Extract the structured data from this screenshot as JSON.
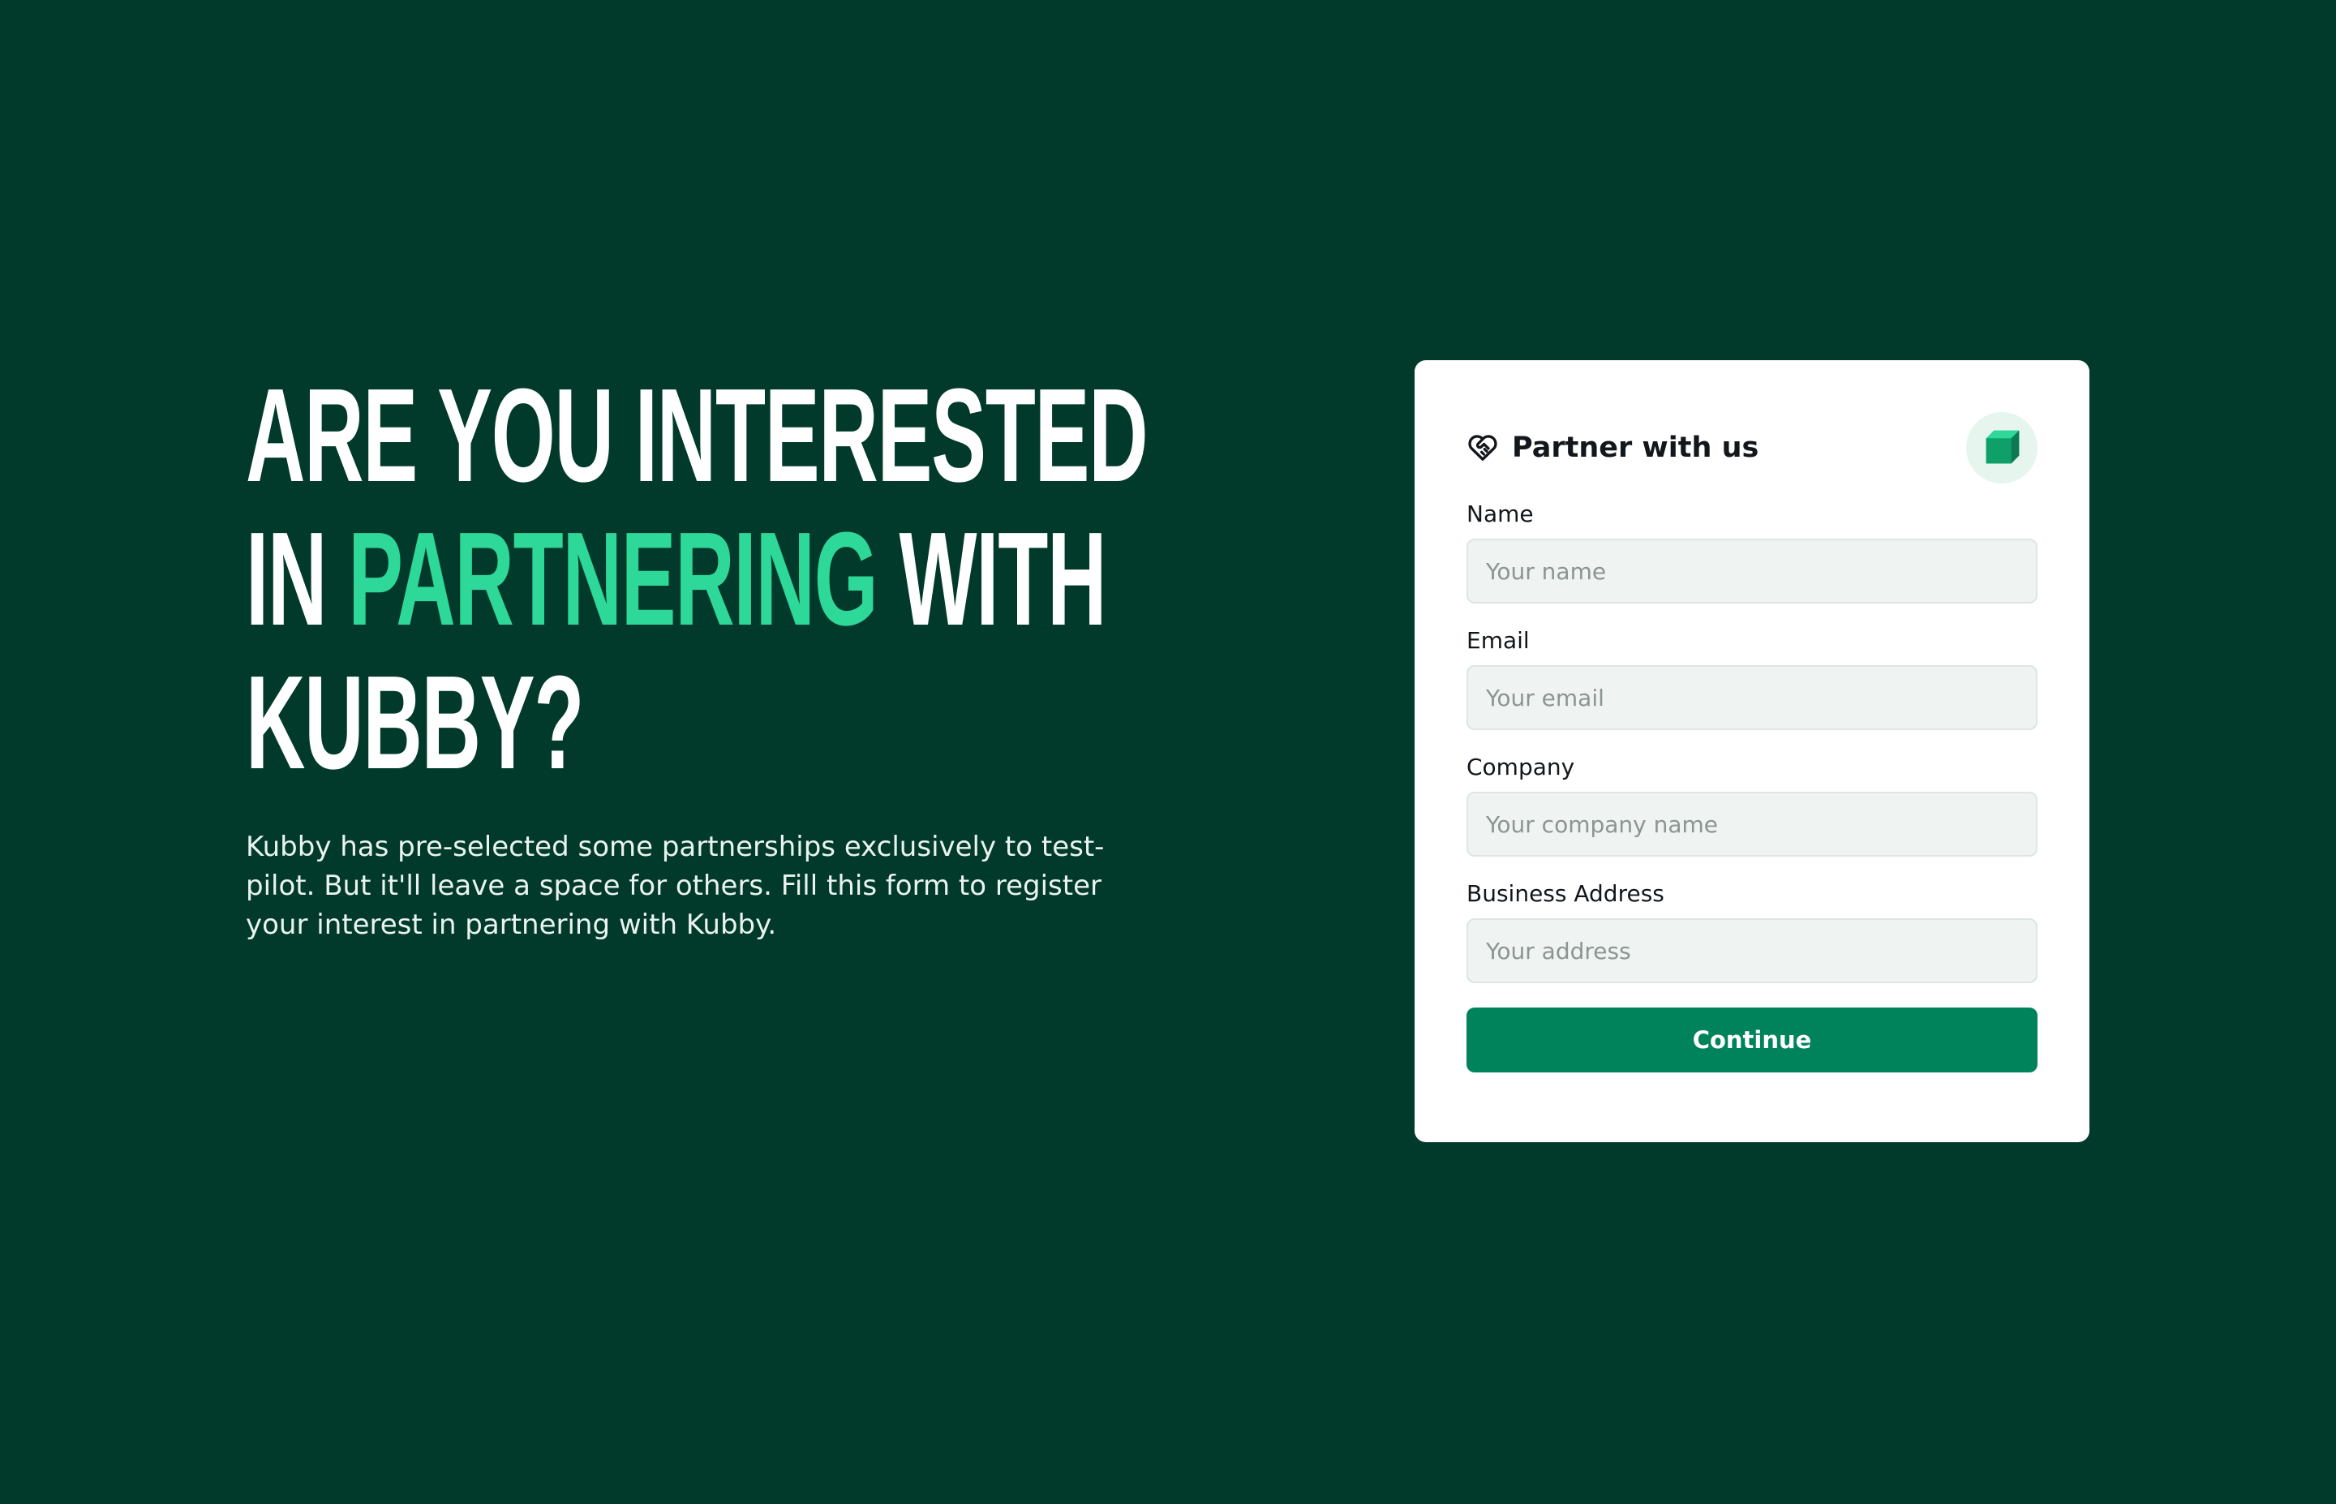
{
  "hero": {
    "headline_line1": "ARE YOU INTERESTED",
    "headline_line2_prefix": "IN ",
    "headline_line2_accent": "PARTNERING",
    "headline_line2_suffix": " WITH",
    "headline_line3": "KUBBY?",
    "description": "Kubby has pre-selected some partnerships exclusively to test-pilot. But it'll leave a space for others. Fill this form to register your interest in partnering with Kubby."
  },
  "form": {
    "title": "Partner with us",
    "title_icon": "handshake-heart-icon",
    "brand_icon": "kubby-cube-logo",
    "fields": {
      "name": {
        "label": "Name",
        "placeholder": "Your name",
        "value": ""
      },
      "email": {
        "label": "Email",
        "placeholder": "Your email",
        "value": ""
      },
      "company": {
        "label": "Company",
        "placeholder": "Your company name",
        "value": ""
      },
      "address": {
        "label": "Business Address",
        "placeholder": "Your address",
        "value": ""
      }
    },
    "submit_label": "Continue"
  },
  "colors": {
    "background": "#013a2b",
    "accent": "#2ed899",
    "button": "#00835a",
    "card": "#ffffff"
  }
}
